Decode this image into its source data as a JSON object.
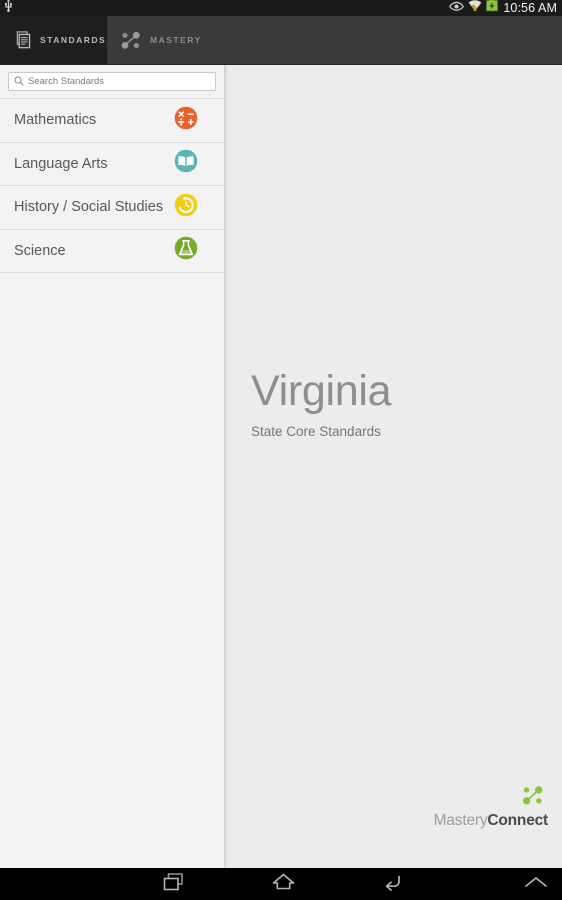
{
  "status_bar": {
    "usb_icon": "usb-icon",
    "eye_icon": "eye-icon",
    "wifi_icon": "wifi-icon",
    "battery_icon": "battery-icon",
    "clock": "10:56 AM",
    "text_color": "#f2f2f2",
    "background": "#1b1b1b",
    "battery_color": "#8cc63e"
  },
  "tabs": [
    {
      "label": "STANDARDS",
      "icon": "documents-icon",
      "active": true
    },
    {
      "label": "MASTERY",
      "icon": "network-nodes-icon",
      "active": false
    }
  ],
  "search": {
    "placeholder": "Search Standards",
    "value": "",
    "icon": "search-icon"
  },
  "sidebar": {
    "subjects": [
      {
        "label": "Mathematics",
        "icon": "math-operators-icon",
        "color": "#e8622a"
      },
      {
        "label": "Language Arts",
        "icon": "open-book-icon",
        "color": "#5cb4b4"
      },
      {
        "label": "History / Social Studies",
        "icon": "history-clock-icon",
        "color": "#f2ce1b"
      },
      {
        "label": "Science",
        "icon": "flask-icon",
        "color": "#76ab2a"
      }
    ]
  },
  "main": {
    "state_name": "Virginia",
    "state_subtitle": "State Core Standards",
    "brand": {
      "part_one": "Mastery",
      "part_two": "Connect",
      "icon": "network-nodes-icon",
      "icon_color": "#8cc63e"
    }
  },
  "nav_bar": {
    "buttons": [
      {
        "name": "recents-button",
        "icon": "recents-icon"
      },
      {
        "name": "home-button",
        "icon": "home-icon"
      },
      {
        "name": "back-button",
        "icon": "back-arrow-icon"
      },
      {
        "name": "expand-button",
        "icon": "chevron-up-icon"
      }
    ]
  }
}
